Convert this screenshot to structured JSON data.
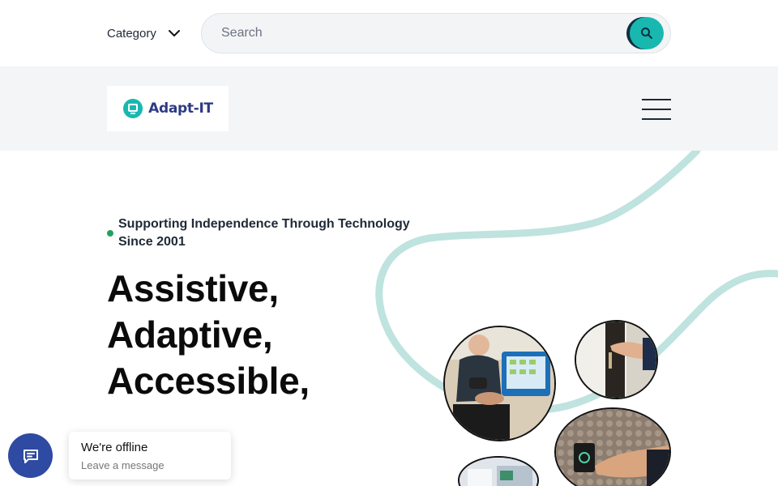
{
  "topbar": {
    "category_label": "Category",
    "search": {
      "placeholder": "Search"
    }
  },
  "header": {
    "logo_text": "Adapt-IT",
    "logo_color": "#2d3b85",
    "accent_color": "#18b8b0"
  },
  "hero": {
    "tagline_line1": "Supporting Independence Through Technology",
    "tagline_line2": "Since 2001",
    "headline": [
      "Assistive,",
      "Adaptive,",
      "Accessible,"
    ],
    "images": [
      "man-using-communication-device-photo",
      "hand-at-door-photo",
      "hand-on-wall-control-panel-photo",
      "office-interior-photo"
    ]
  },
  "chat": {
    "title": "We're offline",
    "subtitle": "Leave a message",
    "button_color": "#2e4aa3"
  },
  "icons": [
    "chevron-down-icon",
    "search-icon",
    "menu-icon",
    "chat-icon"
  ]
}
